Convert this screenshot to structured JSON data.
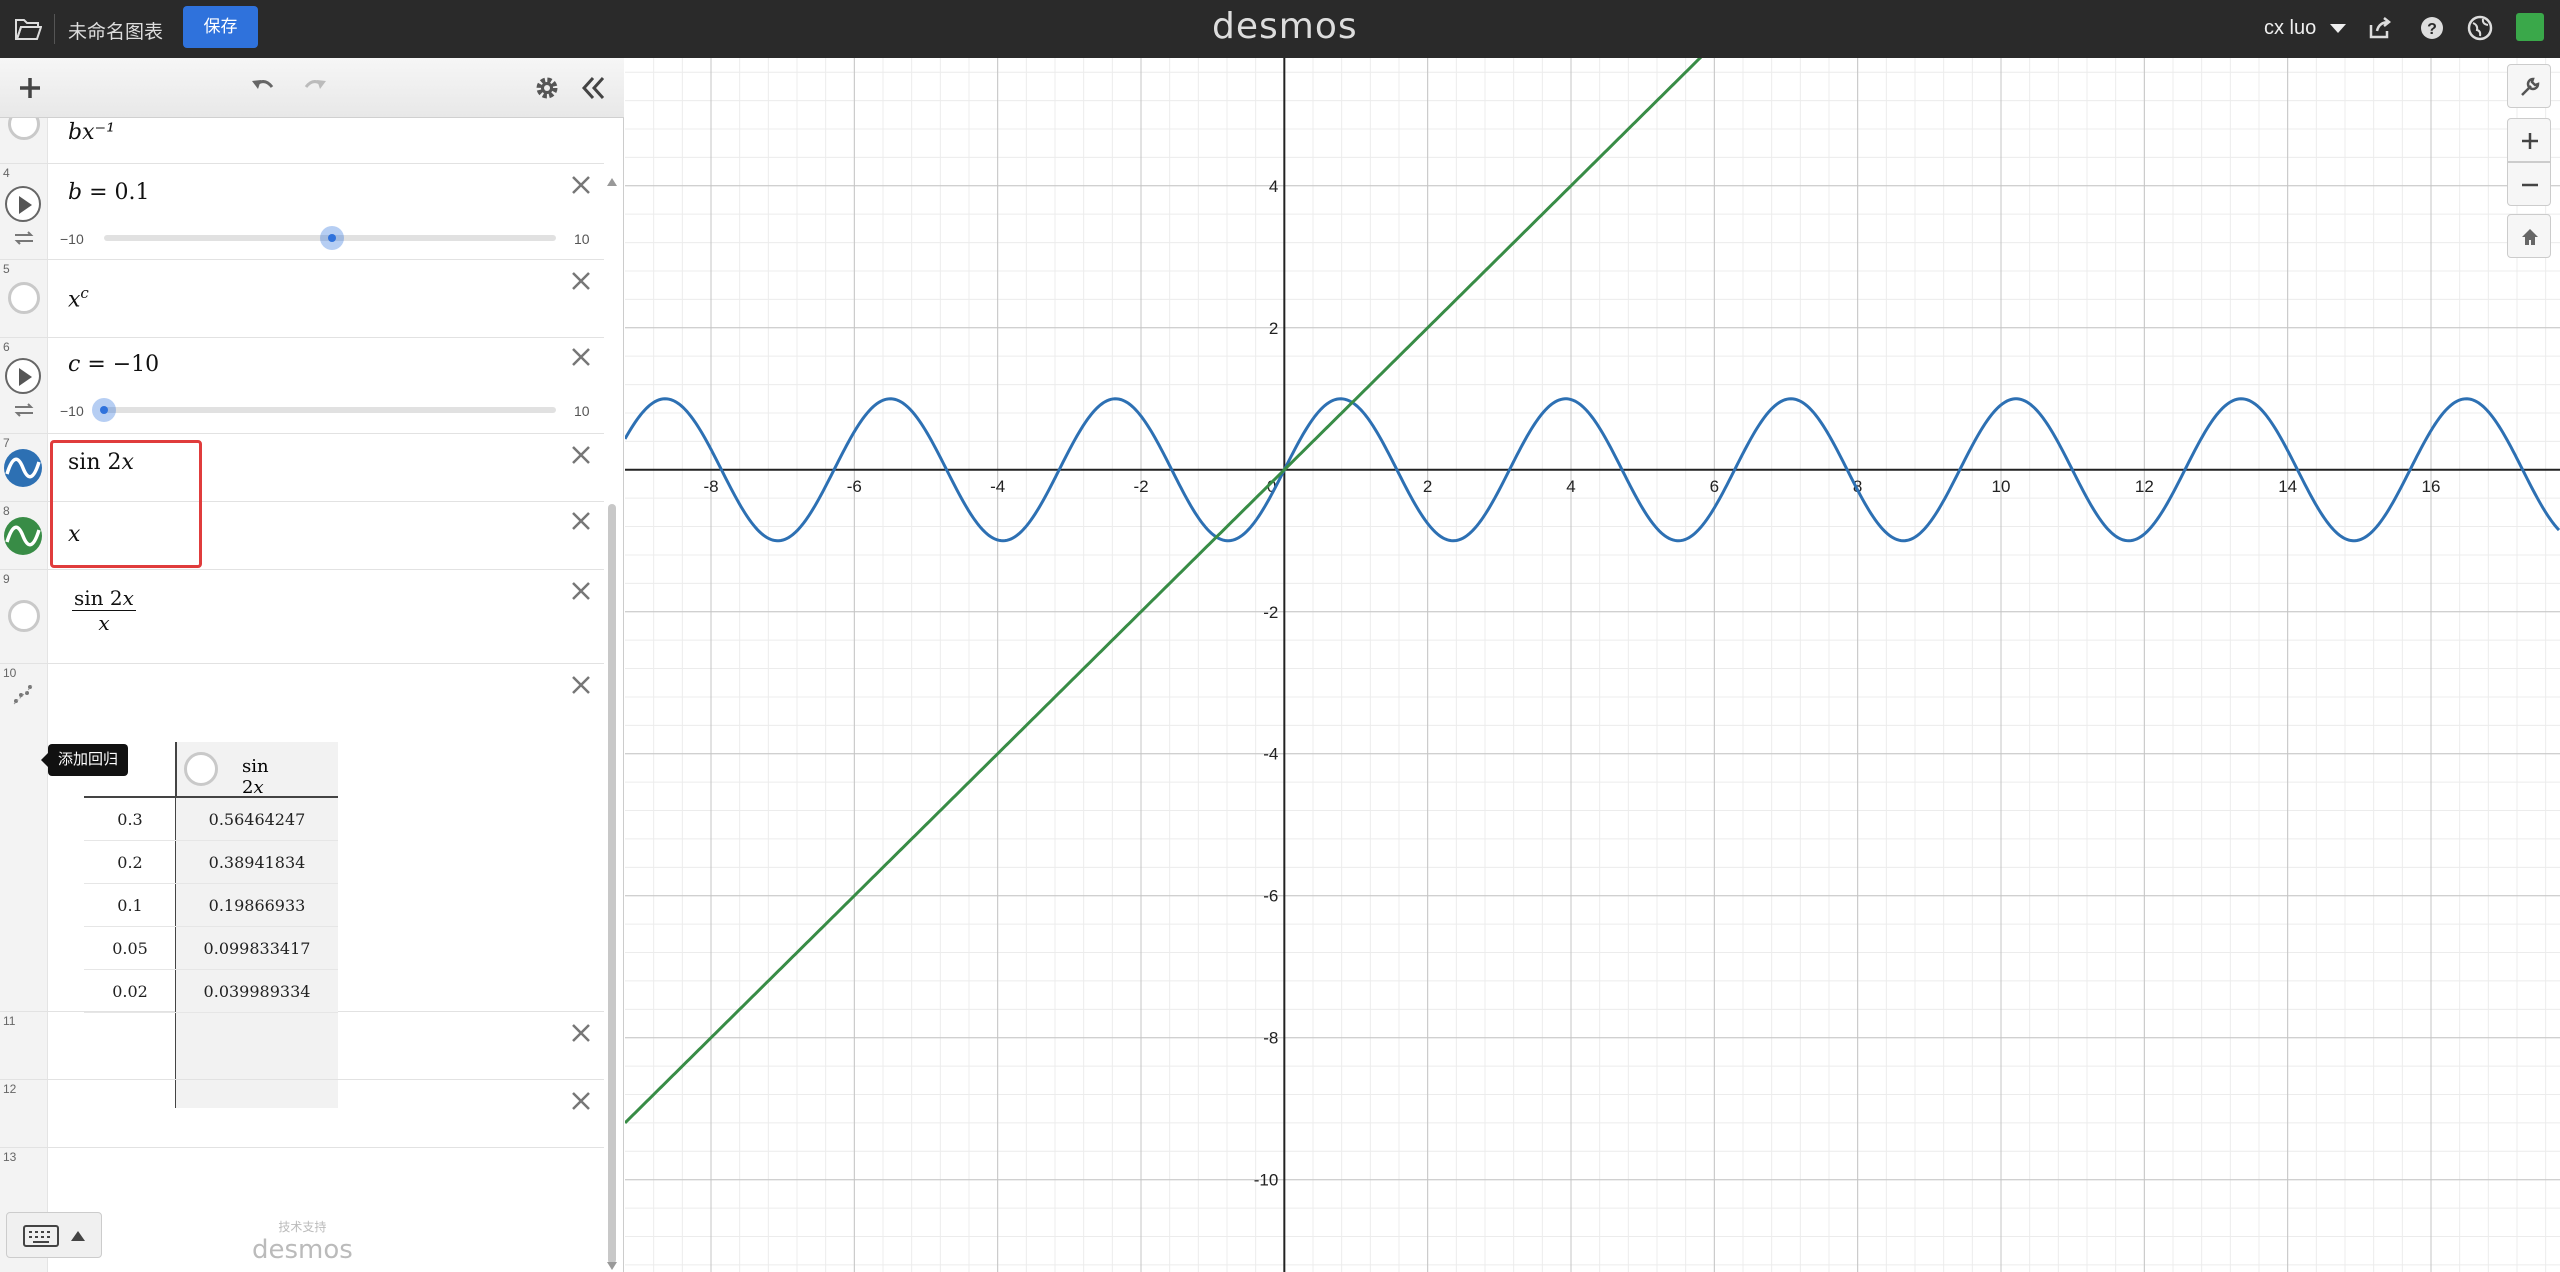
{
  "topbar": {
    "title": "未命名图表",
    "save_label": "保存",
    "logo": "desmos",
    "user": "cx luo"
  },
  "expressions": [
    {
      "index": "",
      "latex_display": "bx⁻¹"
    },
    {
      "index": "4",
      "var": "b",
      "eq": " = 0.1",
      "min": "−10",
      "max": "10",
      "value": 0.1
    },
    {
      "index": "5",
      "base": "x",
      "sup": "c"
    },
    {
      "index": "6",
      "var": "c",
      "eq": " = −10",
      "min": "−10",
      "max": "10",
      "value": -10
    },
    {
      "index": "7",
      "fn": "sin 2",
      "arg": "x",
      "color": "#2d70b3"
    },
    {
      "index": "8",
      "expr": "x",
      "color": "#388c46"
    },
    {
      "index": "9",
      "num_fn": "sin 2",
      "num_arg": "x",
      "den": "x"
    },
    {
      "index": "10",
      "tooltip": "添加回归"
    },
    {
      "index": "11"
    },
    {
      "index": "12"
    },
    {
      "index": "13"
    }
  ],
  "table": {
    "col2_header_fn": "sin 2",
    "col2_header_arg": "x",
    "rows": [
      [
        "0.3",
        "0.56464247"
      ],
      [
        "0.2",
        "0.38941834"
      ],
      [
        "0.1",
        "0.19866933"
      ],
      [
        "0.05",
        "0.099833417"
      ],
      [
        "0.02",
        "0.039989334"
      ]
    ]
  },
  "powered": {
    "small": "技术支持",
    "big": "desmos"
  },
  "graph": {
    "x_ticks": [
      "-8",
      "-6",
      "-4",
      "-2",
      "0",
      "2",
      "4",
      "6",
      "8",
      "10",
      "12",
      "14",
      "16"
    ],
    "y_ticks": [
      "4",
      "2",
      "-2",
      "-4",
      "-6",
      "-8",
      "-10"
    ],
    "xlim": [
      -9.2,
      17.8
    ],
    "ylim": [
      -11.3,
      5.8
    ],
    "curves": [
      {
        "name": "sin 2x",
        "color": "#2d70b3"
      },
      {
        "name": "x",
        "color": "#388c46"
      }
    ]
  }
}
